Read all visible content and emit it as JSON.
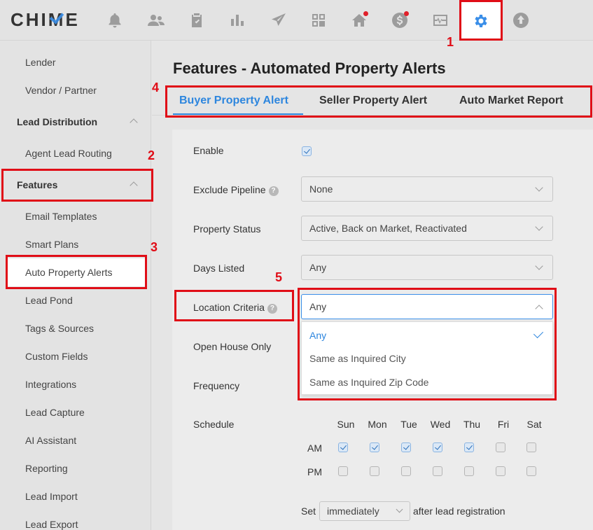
{
  "logo": "CHIME",
  "nav_icons": [
    {
      "name": "bell-money-icon",
      "dot": false
    },
    {
      "name": "people-icon",
      "dot": false
    },
    {
      "name": "clipboard-icon",
      "dot": false
    },
    {
      "name": "bar-chart-icon",
      "dot": false
    },
    {
      "name": "paper-plane-icon",
      "dot": false
    },
    {
      "name": "grid-icon",
      "dot": false
    },
    {
      "name": "home-icon",
      "dot": true
    },
    {
      "name": "dollar-icon",
      "dot": true
    },
    {
      "name": "pulse-icon",
      "dot": false
    },
    {
      "name": "gear-icon",
      "dot": false,
      "active": true
    },
    {
      "name": "upload-icon",
      "dot": false
    }
  ],
  "sidebar": {
    "items": [
      {
        "label": "Lender"
      },
      {
        "label": "Vendor / Partner"
      },
      {
        "label": "Lead Distribution",
        "section": true
      },
      {
        "label": "Agent Lead Routing"
      },
      {
        "label": "Features",
        "section": true
      },
      {
        "label": "Email Templates"
      },
      {
        "label": "Smart Plans"
      },
      {
        "label": "Auto Property Alerts"
      },
      {
        "label": "Lead Pond"
      },
      {
        "label": "Tags & Sources"
      },
      {
        "label": "Custom Fields"
      },
      {
        "label": "Integrations"
      },
      {
        "label": "Lead Capture"
      },
      {
        "label": "AI Assistant"
      },
      {
        "label": "Reporting"
      },
      {
        "label": "Lead Import"
      },
      {
        "label": "Lead Export"
      }
    ]
  },
  "page": {
    "title": "Features - Automated Property Alerts",
    "tabs": [
      {
        "label": "Buyer Property Alert",
        "active": true
      },
      {
        "label": "Seller Property Alert"
      },
      {
        "label": "Auto Market Report"
      }
    ]
  },
  "form": {
    "enable_label": "Enable",
    "enable_checked": true,
    "exclude_pipeline_label": "Exclude Pipeline",
    "exclude_pipeline_value": "None",
    "property_status_label": "Property Status",
    "property_status_value": "Active, Back on Market, Reactivated",
    "days_listed_label": "Days Listed",
    "days_listed_value": "Any",
    "location_criteria_label": "Location Criteria",
    "location_criteria_value": "Any",
    "location_options": [
      {
        "label": "Any",
        "selected": true
      },
      {
        "label": "Same as Inquired City"
      },
      {
        "label": "Same as Inquired Zip Code"
      }
    ],
    "open_house_label": "Open House Only",
    "frequency_label": "Frequency",
    "schedule_label": "Schedule",
    "days": [
      "Sun",
      "Mon",
      "Tue",
      "Wed",
      "Thu",
      "Fri",
      "Sat"
    ],
    "am_label": "AM",
    "pm_label": "PM",
    "am_checked": [
      true,
      true,
      true,
      true,
      true,
      false,
      false
    ],
    "pm_checked": [
      false,
      false,
      false,
      false,
      false,
      false,
      false
    ],
    "set_prefix": "Set",
    "set_value": "immediately",
    "set_suffix": "after lead registration"
  },
  "annotations": [
    "1",
    "2",
    "3",
    "4",
    "5"
  ],
  "colors": {
    "accent": "#2d86de",
    "annotation": "#e00d17"
  }
}
